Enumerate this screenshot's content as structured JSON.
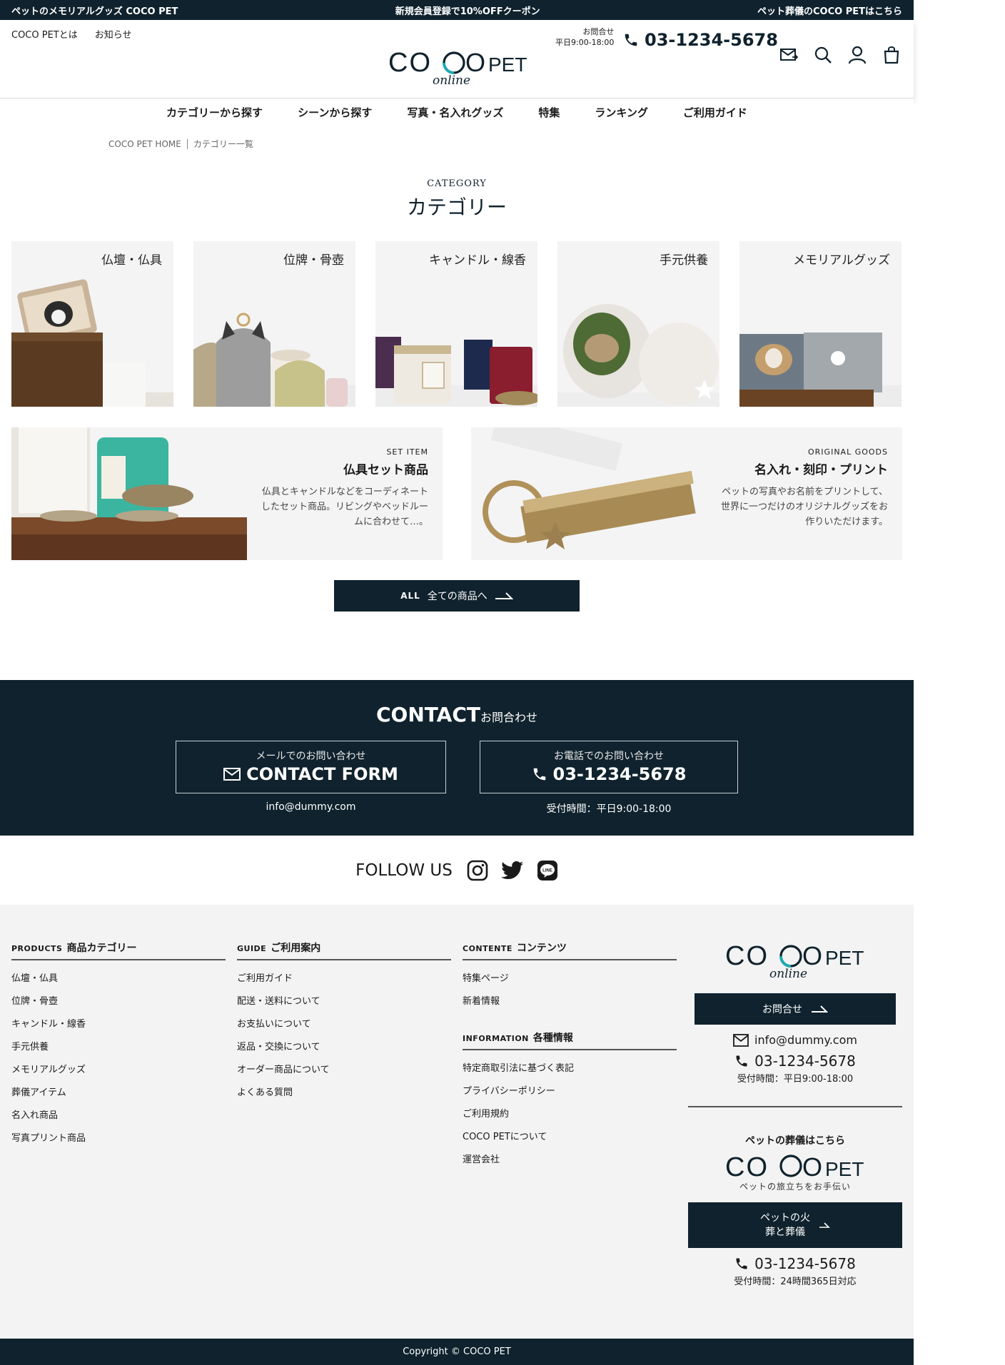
{
  "topbar": {
    "left": "ペットのメモリアルグッズ COCO PET",
    "center": "新規会員登録で10%OFFクーポン",
    "right": "ペット葬儀のCOCO PETはこちら"
  },
  "header": {
    "link_about": "COCO PETとは",
    "link_news": "お知らせ",
    "logo_main": "COCOPET",
    "logo_sub": "online",
    "contact_label": "お問合せ",
    "contact_hours": "平日9:00-18:00",
    "phone": "03-1234-5678"
  },
  "icons": {
    "mail": "mail-icon",
    "search": "search-icon",
    "user": "user-icon",
    "cart": "cart-icon",
    "phone": "phone-icon"
  },
  "nav": [
    "カテゴリーから探す",
    "シーンから探す",
    "写真・名入れグッズ",
    "特集",
    "ランキング",
    "ご利用ガイド"
  ],
  "breadcrumb": {
    "home": "COCO PET HOME",
    "current": "カテゴリー一覧"
  },
  "category": {
    "en": "CATEGORY",
    "ja": "カテゴリー",
    "cards": [
      "仏壇・仏具",
      "位牌・骨壺",
      "キャンドル・線香",
      "手元供養",
      "メモリアルグッズ"
    ],
    "set": {
      "en": "SET ITEM",
      "title": "仏具セット商品",
      "desc": "仏具とキャンドルなどをコーディネートしたセット商品。リビングやベッドルームに合わせて…。"
    },
    "original": {
      "en": "ORIGINAL GOODS",
      "title": "名入れ・刻印・プリント",
      "desc": "ペットの写真やお名前をプリントして、世界に一つだけのオリジナルグッズをお作りいただけます。"
    },
    "all_en": "ALL",
    "all_ja": "全ての商品へ"
  },
  "contact": {
    "title_en": "CONTACT",
    "title_ja": "お問合わせ",
    "mail_sub": "メールでのお問い合わせ",
    "mail_main": "CONTACT FORM",
    "mail_note": "info@dummy.com",
    "tel_sub": "お電話でのお問い合わせ",
    "tel_main": "03-1234-5678",
    "tel_note": "受付時間：平日9:00-18:00"
  },
  "follow": {
    "label": "FOLLOW US"
  },
  "footer": {
    "products": {
      "en": "PRODUCTS",
      "ja": "商品カテゴリー",
      "items": [
        "仏壇・仏具",
        "位牌・骨壺",
        "キャンドル・線香",
        "手元供養",
        "メモリアルグッズ",
        "葬儀アイテム",
        "名入れ商品",
        "写真プリント商品"
      ]
    },
    "guide": {
      "en": "GUIDE",
      "ja": "ご利用案内",
      "items": [
        "ご利用ガイド",
        "配送・送料について",
        "お支払いについて",
        "返品・交換について",
        "オーダー商品について",
        "よくある質問"
      ]
    },
    "contents": {
      "en": "CONTENTE",
      "ja": "コンテンツ",
      "items": [
        "特集ページ",
        "新着情報"
      ]
    },
    "info": {
      "en": "INFORMATION",
      "ja": "各種情報",
      "items": [
        "特定商取引法に基づく表記",
        "プライバシーポリシー",
        "ご利用規約",
        "COCO PETについて",
        "運営会社"
      ]
    },
    "right": {
      "contact_btn": "お問合せ",
      "email": "info@dummy.com",
      "phone": "03-1234-5678",
      "hours": "受付時間：平日9:00-18:00",
      "funeral_title": "ペットの葬儀はこちら",
      "funeral_tagline": "ペットの旅立ちをお手伝い",
      "funeral_btn_1": "ペットの火",
      "funeral_btn_2": "葬と葬儀",
      "funeral_phone": "03-1234-5678",
      "funeral_hours": "受付時間：24時間365日対応"
    }
  },
  "copyright": "Copyright © COCO PET",
  "colors": {
    "navy": "#0f222d",
    "teal": "#1fa9b0",
    "panel": "#f4f4f4"
  }
}
